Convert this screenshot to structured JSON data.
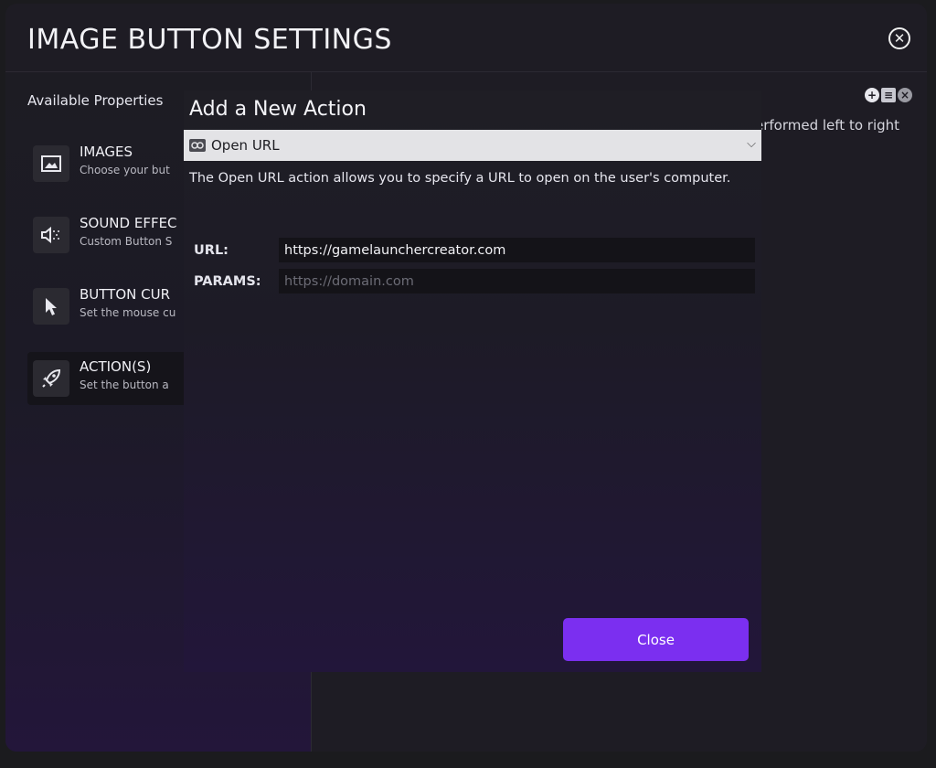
{
  "window": {
    "title": "IMAGE BUTTON SETTINGS"
  },
  "sidebar": {
    "heading": "Available Properties",
    "items": [
      {
        "icon": "image-icon",
        "title": "IMAGES",
        "desc": "Choose your but"
      },
      {
        "icon": "speaker-icon",
        "title": "SOUND EFFEC",
        "desc": "Custom Button S"
      },
      {
        "icon": "cursor-icon",
        "title": "BUTTON CUR",
        "desc": "Set the mouse cu"
      },
      {
        "icon": "rocket-icon",
        "title": "ACTION(S)",
        "desc": "Set the button a",
        "active": true
      }
    ]
  },
  "right_panel": {
    "text": "erformed left to right",
    "icons": [
      "add-icon",
      "list-icon",
      "remove-icon"
    ]
  },
  "modal": {
    "title": "Add a New Action",
    "select": {
      "icon": "link-icon",
      "value": "Open URL"
    },
    "description": "The Open URL action allows you to specify a URL to open on the user's computer.",
    "fields": {
      "url": {
        "label": "URL:",
        "value": "https://gamelaunchercreator.com",
        "placeholder": ""
      },
      "params": {
        "label": "PARAMS:",
        "value": "",
        "placeholder": "https://domain.com"
      }
    },
    "close_label": "Close"
  },
  "colors": {
    "accent": "#7b2ff0",
    "background": "#1e1c24"
  }
}
